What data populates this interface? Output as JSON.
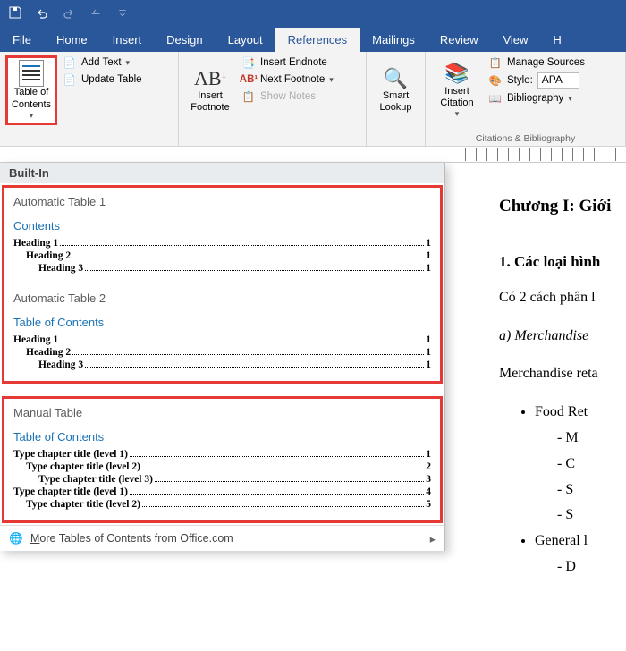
{
  "qat": {
    "save": "save",
    "undo": "undo",
    "redo": "redo"
  },
  "tabs": [
    "File",
    "Home",
    "Insert",
    "Design",
    "Layout",
    "References",
    "Mailings",
    "Review",
    "View",
    "H"
  ],
  "active_tab": "References",
  "ribbon": {
    "toc_btn": "Table of\nContents",
    "add_text": "Add Text",
    "update_table": "Update Table",
    "insert_footnote": "Insert\nFootnote",
    "ab_icon": "AB",
    "insert_endnote": "Insert Endnote",
    "next_footnote": "Next Footnote",
    "show_notes": "Show Notes",
    "smart_lookup": "Smart\nLookup",
    "insert_citation": "Insert\nCitation",
    "manage_sources": "Manage Sources",
    "style_label": "Style:",
    "style_value": "APA",
    "bibliography": "Bibliography",
    "cit_group": "Citations & Bibliography"
  },
  "gallery": {
    "built_in": "Built-In",
    "auto1": {
      "title": "Automatic Table 1",
      "hdr": "Contents",
      "rows": [
        {
          "t": "Heading 1",
          "p": "1",
          "i": 0
        },
        {
          "t": "Heading 2",
          "p": "1",
          "i": 14
        },
        {
          "t": "Heading 3",
          "p": "1",
          "i": 28
        }
      ]
    },
    "auto2": {
      "title": "Automatic Table 2",
      "hdr": "Table of Contents",
      "rows": [
        {
          "t": "Heading 1",
          "p": "1",
          "i": 0
        },
        {
          "t": "Heading 2",
          "p": "1",
          "i": 14
        },
        {
          "t": "Heading 3",
          "p": "1",
          "i": 28
        }
      ]
    },
    "manual": {
      "title": "Manual Table",
      "hdr": "Table of Contents",
      "rows": [
        {
          "t": "Type chapter title (level 1)",
          "p": "1",
          "i": 0
        },
        {
          "t": "Type chapter title (level 2)",
          "p": "2",
          "i": 14
        },
        {
          "t": "Type chapter title (level 3)",
          "p": "3",
          "i": 28
        },
        {
          "t": "Type chapter title (level 1)",
          "p": "4",
          "i": 0
        },
        {
          "t": "Type chapter title (level 2)",
          "p": "5",
          "i": 14
        }
      ]
    },
    "more": "More Tables of Contents from Office.com"
  },
  "doc": {
    "h1": "Chương I: Giới",
    "h2": "1. Các loại hình",
    "p1": "Có 2 cách phân l",
    "pa": "a) Merchandise",
    "p2": "Merchandise reta",
    "b1": "Food Ret",
    "b1a": "M",
    "b1b": "C",
    "b1c": "S",
    "b1d": "S",
    "b2": "General l",
    "b2a": "D"
  }
}
